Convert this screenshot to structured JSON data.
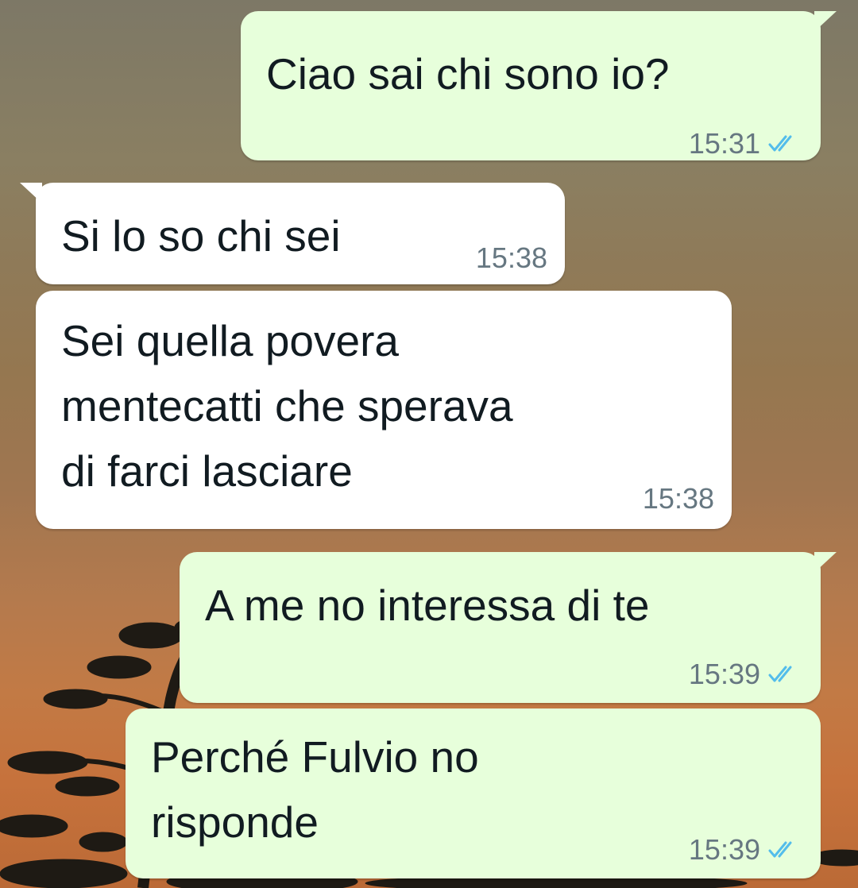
{
  "chat": {
    "messages": [
      {
        "id": "m1",
        "direction": "outgoing",
        "text": "Ciao sai chi sono io?",
        "time": "15:31",
        "status": "read",
        "status_icon": "double-check-icon"
      },
      {
        "id": "m2",
        "direction": "incoming",
        "text": "Si lo so chi sei",
        "time": "15:38"
      },
      {
        "id": "m3",
        "direction": "incoming",
        "text": "Sei quella povera\nmentecatti che sperava\ndi farci lasciare",
        "time": "15:38"
      },
      {
        "id": "m4",
        "direction": "outgoing",
        "text": "A me no interessa di te",
        "time": "15:39",
        "status": "read",
        "status_icon": "double-check-icon"
      },
      {
        "id": "m5",
        "direction": "outgoing",
        "text": "Perché Fulvio no\nrisponde",
        "time": "15:39",
        "status": "read",
        "status_icon": "double-check-icon"
      }
    ]
  },
  "colors": {
    "outgoing_bubble": "#e7ffdb",
    "incoming_bubble": "#ffffff",
    "read_ticks": "#53bdeb",
    "timestamp": "#667781",
    "message_text": "#111b21"
  }
}
